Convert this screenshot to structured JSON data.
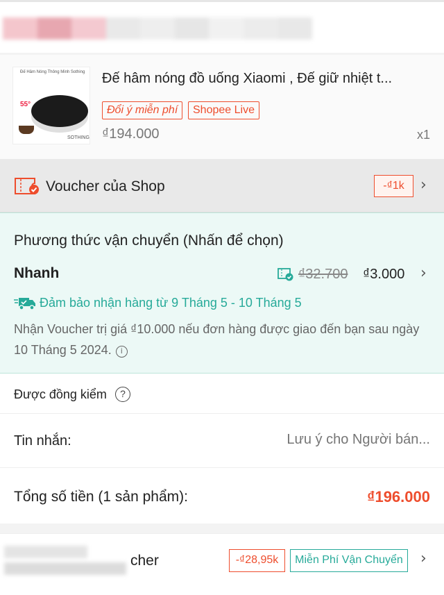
{
  "colors": {
    "accent": "#ee4d2d",
    "teal": "#26aa99",
    "shipping_bg": "#ecf9f6",
    "blur_swatches": [
      "#f4c6cc",
      "#e7a7b0",
      "#f4c9d0",
      "#e9e9e9",
      "#eeeeee",
      "#e6e6e6",
      "#f1f1f1",
      "#ececec",
      "#e8e8e8"
    ]
  },
  "product": {
    "thumbnail": {
      "brand_text": "Đế Hâm Nóng Thông Minh Sothing",
      "temp": "55°",
      "mark": "SOTHING"
    },
    "title": "Đế hâm nóng đồ uống Xiaomi , Đế giữ nhiệt t...",
    "tags": [
      "Đổi ý miễn phí",
      "Shopee Live"
    ],
    "price": "₫194.000",
    "quantity": "x1"
  },
  "shop_voucher": {
    "label": "Voucher của Shop",
    "badge": "-₫1k",
    "icon": "voucher-ticket-icon"
  },
  "shipping": {
    "heading": "Phương thức vận chuyển (Nhấn để chọn)",
    "method": "Nhanh",
    "old_price": "₫32.700",
    "new_price": "₫3.000",
    "guarantee": "Đảm bảo nhận hàng từ 9 Tháng 5 - 10 Tháng 5",
    "note": "Nhận Voucher trị giá ₫10.000 nếu đơn hàng được giao đến bạn sau ngày 10 Tháng 5 2024."
  },
  "inspection": {
    "label": "Được đồng kiểm"
  },
  "message": {
    "label": "Tin nhắn:",
    "placeholder": "Lưu ý cho Người bán..."
  },
  "total": {
    "label": "Tổng số tiền (1 sản phẩm):",
    "value": "₫196.000"
  },
  "next_shop": {
    "partial_text": "cher",
    "discount_badge": "-₫28,95k",
    "free_ship_badge": "Miễn Phí Vận Chuyển"
  }
}
